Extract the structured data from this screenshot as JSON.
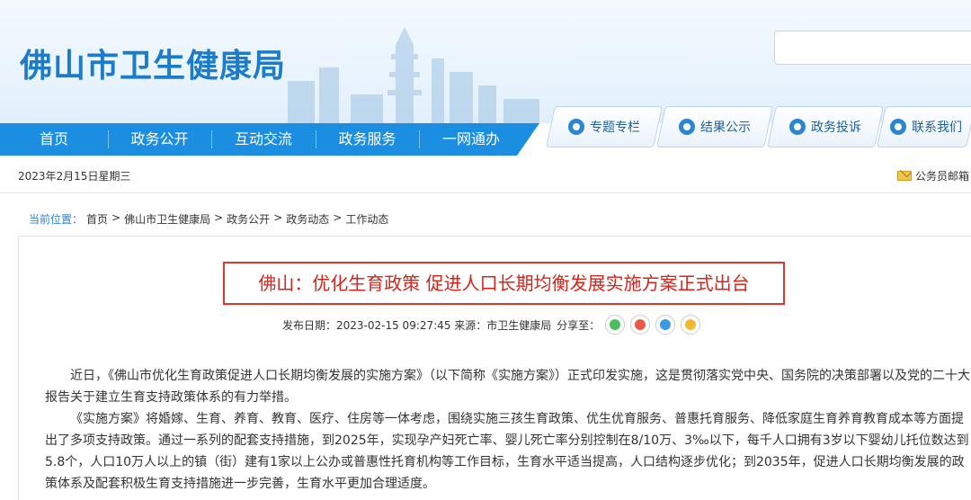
{
  "header": {
    "site_title": "佛山市卫生健康局",
    "search": {
      "placeholder": ""
    }
  },
  "nav": {
    "items": [
      "首页",
      "政务公开",
      "互动交流",
      "政务服务",
      "一网通办"
    ]
  },
  "quick_links": [
    {
      "label": "专题专栏",
      "icon": "topic-icon"
    },
    {
      "label": "结果公示",
      "icon": "result-icon"
    },
    {
      "label": "政务投诉",
      "icon": "complaint-icon"
    },
    {
      "label": "联系我们",
      "icon": "contact-icon"
    }
  ],
  "date_text": "2023年2月15日星期三",
  "mail_label": "公务员邮箱",
  "breadcrumb": {
    "lead": "当前位置：",
    "items": [
      "首页",
      "佛山市卫生健康局",
      "政务公开",
      "政务动态",
      "工作动态"
    ],
    "separator": ">"
  },
  "article": {
    "title": "佛山：优化生育政策 促进人口长期均衡发展实施方案正式出台",
    "meta": "发布日期：2023-02-15 09:27:45 来源：市卫生健康局",
    "share_label": "分享至：",
    "share_icons": [
      "wechat-icon",
      "weibo-icon",
      "qq-icon",
      "favorite-icon"
    ],
    "paragraph_1": "近日，《佛山市优化生育政策促进人口长期均衡发展的实施方案》（以下简称《实施方案》）正式印发实施，这是贯彻落实党中央、国务院的决策部署以及党的二十大报告关于建立生育支持政策体系的有力举措。",
    "paragraph_2": "《实施方案》将婚嫁、生育、养育、教育、医疗、住房等一体考虑，围绕实施三孩生育政策、优生优育服务、普惠托育服务、降低家庭生育养育教育成本等方面提出了多项支持政策。通过一系列的配套支持措施，到2025年，实现孕产妇死亡率、婴儿死亡率分别控制在8/10万、3‰以下，每千人口拥有3岁以下婴幼儿托位数达到5.8个，人口10万人以上的镇（街）建有1家以上公办或普惠性托育机构等工作目标，生育水平适当提高，人口结构逐步优化；到2035年，促进人口长期均衡发展的政策体系及配套积极生育支持措施进一步完善，生育水平更加合理适度。"
  },
  "colors": {
    "brand_blue": "#1d7cc9",
    "nav_blue": "#1b8ee2",
    "title_red": "#d7241b"
  }
}
